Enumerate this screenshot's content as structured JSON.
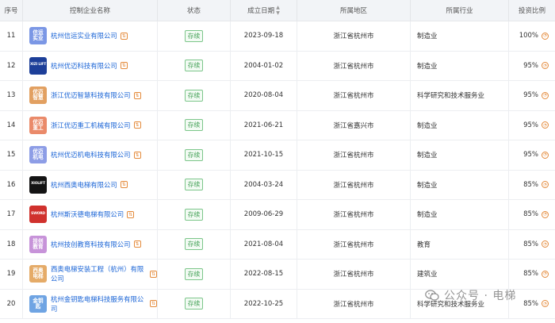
{
  "headers": {
    "index": "序号",
    "name": "控制企业名称",
    "status": "状态",
    "date": "成立日期",
    "date_sort_icon": "sort-icon",
    "region": "所属地区",
    "industry": "所属行业",
    "ratio": "投资比例"
  },
  "rows": [
    {
      "index": "11",
      "logo_text": "信运\n实业",
      "logo_color": "#7b97e5",
      "name": "杭州信运实业有限公司",
      "status": "存续",
      "date": "2023-09-18",
      "region": "浙江省杭州市",
      "industry": "制造业",
      "ratio": "100%"
    },
    {
      "index": "12",
      "logo_text": "XIZI LIFT",
      "logo_color": "#1d3f99",
      "name": "杭州优迈科技有限公司",
      "status": "存续",
      "date": "2004-01-02",
      "region": "浙江省杭州市",
      "industry": "制造业",
      "ratio": "95%"
    },
    {
      "index": "13",
      "logo_text": "优迈\n智慧",
      "logo_color": "#e2a061",
      "name": "浙江优迈智慧科技有限公司",
      "status": "存续",
      "date": "2020-08-04",
      "region": "浙江省杭州市",
      "industry": "科学研究和技术服务业",
      "ratio": "95%"
    },
    {
      "index": "14",
      "logo_text": "优迈\n重工",
      "logo_color": "#ea8a6a",
      "name": "浙江优迈重工机械有限公司",
      "status": "存续",
      "date": "2021-06-21",
      "region": "浙江省嘉兴市",
      "industry": "制造业",
      "ratio": "95%"
    },
    {
      "index": "15",
      "logo_text": "优迈\n机电",
      "logo_color": "#8d9de6",
      "name": "杭州优迈机电科技有限公司",
      "status": "存续",
      "date": "2021-10-15",
      "region": "浙江省杭州市",
      "industry": "制造业",
      "ratio": "95%"
    },
    {
      "index": "16",
      "logo_text": "XIOLIFT",
      "logo_color": "#141414",
      "name": "杭州西奥电梯有限公司",
      "status": "存续",
      "date": "2004-03-24",
      "region": "浙江省杭州市",
      "industry": "制造业",
      "ratio": "85%"
    },
    {
      "index": "17",
      "logo_text": "SWORD",
      "logo_color": "#d0312d",
      "name": "杭州斯沃德电梯有限公司",
      "status": "存续",
      "date": "2009-06-29",
      "region": "浙江省杭州市",
      "industry": "制造业",
      "ratio": "85%"
    },
    {
      "index": "18",
      "logo_text": "技创\n教育",
      "logo_color": "#c793d9",
      "name": "杭州技创教育科技有限公司",
      "status": "存续",
      "date": "2021-08-04",
      "region": "浙江省杭州市",
      "industry": "教育",
      "ratio": "85%"
    },
    {
      "index": "19",
      "logo_text": "西奥\n电梯",
      "logo_color": "#e5ab68",
      "name": "西奥电梯安装工程（杭州）有限公司",
      "status": "存续",
      "date": "2022-08-15",
      "region": "浙江省杭州市",
      "industry": "建筑业",
      "ratio": "85%"
    },
    {
      "index": "20",
      "logo_text": "金钥\n匙",
      "logo_color": "#6fa4e3",
      "name": "杭州金钥匙电梯科技服务有限公司",
      "status": "存续",
      "date": "2022-10-25",
      "region": "浙江省杭州市",
      "industry": "科学研究和技术服务业",
      "ratio": "85%"
    }
  ],
  "watermark": {
    "text": "公众号 · 电梯",
    "icon": "wechat-icon"
  },
  "colors": {
    "link": "#1a64d6",
    "status_border": "#7cc68a",
    "status_text": "#3f9e52",
    "accent": "#e48a3a",
    "header_bg": "#f2f4f7"
  }
}
